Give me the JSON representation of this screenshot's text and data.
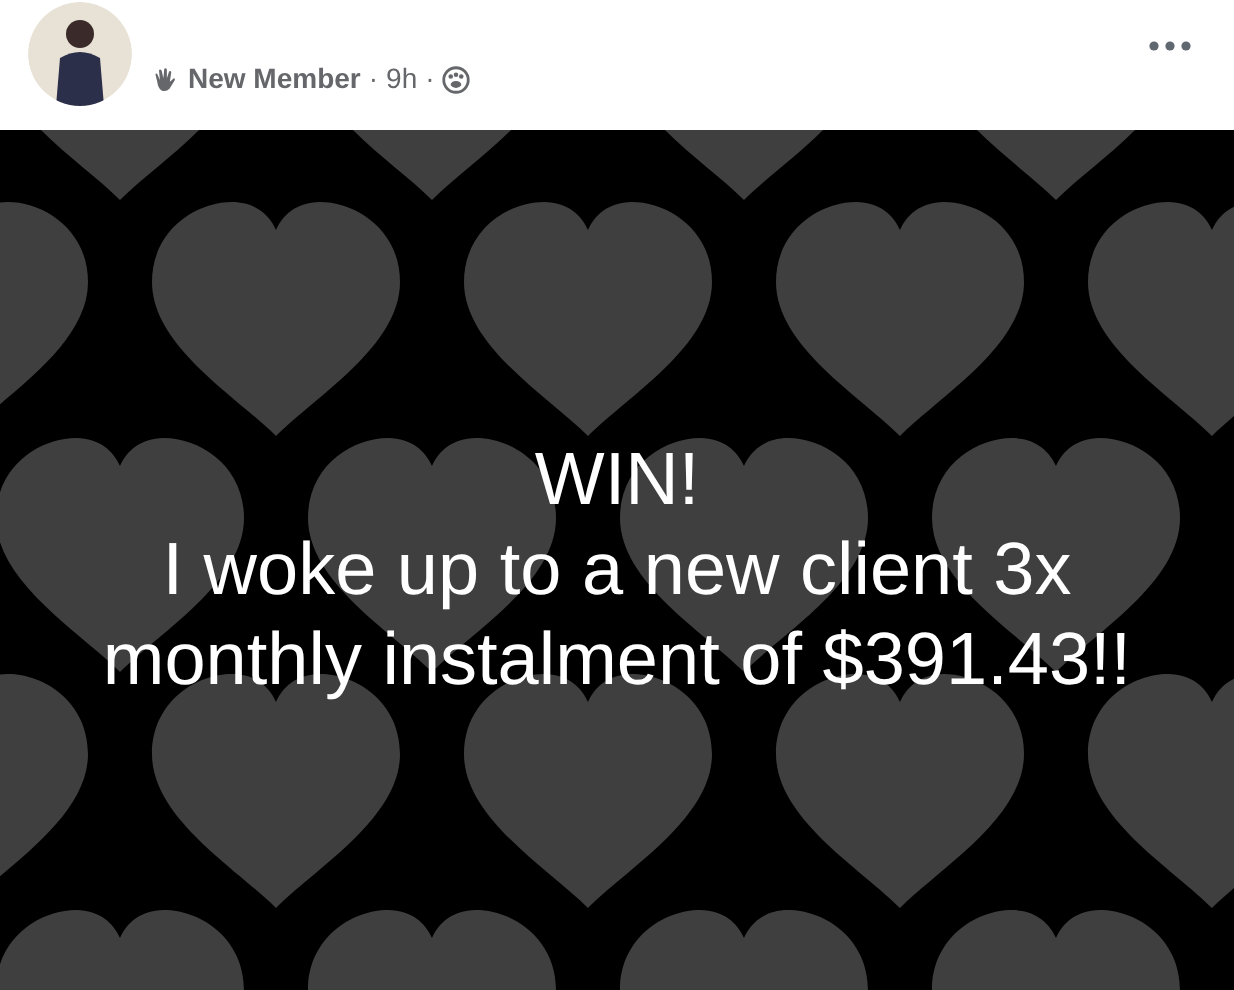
{
  "post": {
    "badge": "New Member",
    "separator_1": "·",
    "time": "9h",
    "separator_2": "·",
    "text_lines": [
      "WIN!",
      "I woke up to a new client 3x",
      "monthly instalment of $391.43!!"
    ]
  }
}
